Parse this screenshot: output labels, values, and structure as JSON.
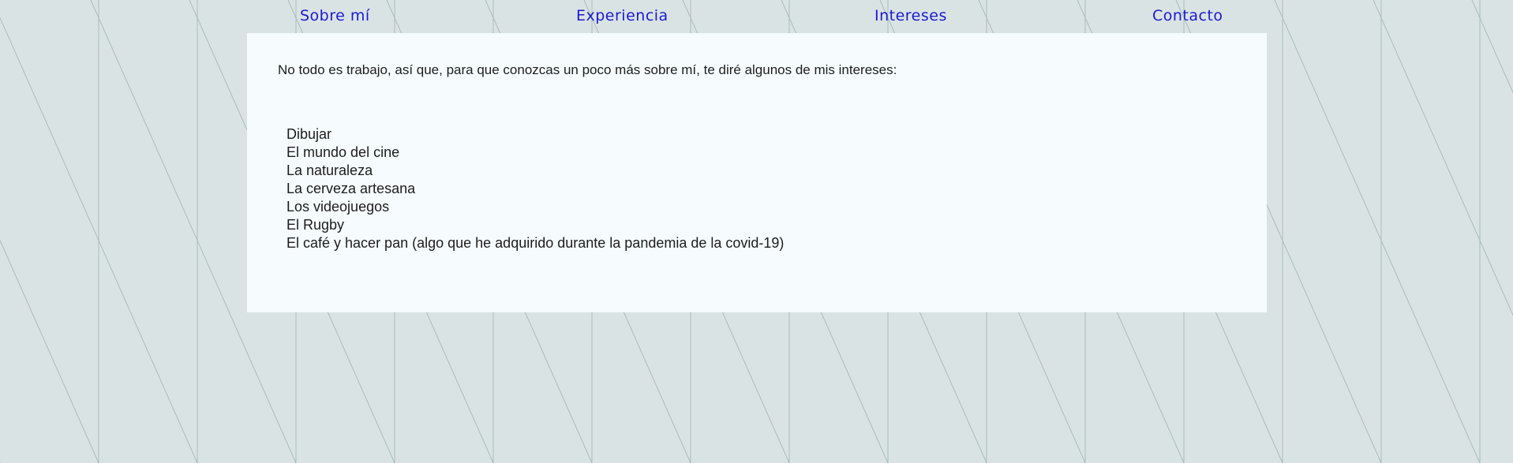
{
  "nav": {
    "items": [
      {
        "label": "Sobre mí"
      },
      {
        "label": "Experiencia"
      },
      {
        "label": "Intereses"
      },
      {
        "label": "Contacto"
      }
    ]
  },
  "content": {
    "intro": "No todo es trabajo, así que, para que conozcas un poco más sobre mí, te diré algunos de mis intereses:",
    "interests": [
      "Dibujar",
      "El mundo del cine",
      "La naturaleza",
      "La cerveza artesana",
      "Los videojuegos",
      "El Rugby",
      "El café y hacer pan (algo que he adquirido durante la pandemia de la covid-19)"
    ]
  },
  "colors": {
    "background": "#dae3e3",
    "pattern_lines": "#a9bcbc",
    "link": "#1a1ad4",
    "panel": "#f6fbfd",
    "text": "#1d1d1d"
  }
}
